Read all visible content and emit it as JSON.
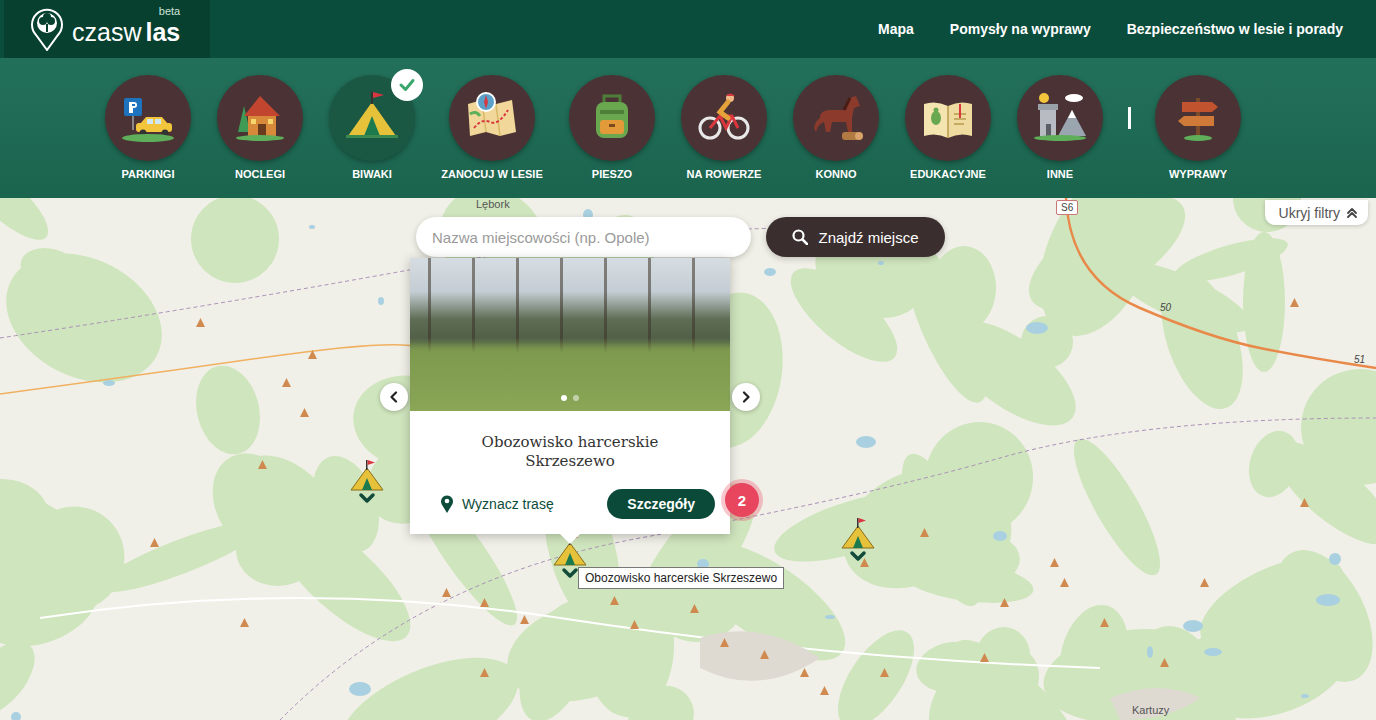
{
  "logo": {
    "parts": [
      {
        "text": "czas",
        "bold": false
      },
      {
        "text": "w",
        "bold": false
      },
      {
        "text": "las",
        "bold": true
      }
    ],
    "badge": "beta"
  },
  "nav": [
    {
      "label": "Mapa"
    },
    {
      "label": "Pomysły na wyprawy"
    },
    {
      "label": "Bezpieczeństwo w lesie i porady"
    }
  ],
  "categories": [
    {
      "label": "PARKINGI",
      "selected": false
    },
    {
      "label": "NOCLEGI",
      "selected": false
    },
    {
      "label": "BIWAKI",
      "selected": true
    },
    {
      "label": "ZANOCUJ W LESIE",
      "selected": false
    },
    {
      "label": "PIESZO",
      "selected": false
    },
    {
      "label": "NA ROWERZE",
      "selected": false
    },
    {
      "label": "KONNO",
      "selected": false
    },
    {
      "label": "EDUKACYJNE",
      "selected": false
    },
    {
      "label": "INNE",
      "selected": false
    }
  ],
  "trips": {
    "label": "WYPRAWY"
  },
  "filters_toggle": "Ukryj filtry",
  "search": {
    "placeholder": "Nazwa miejscowości (np. Opole)",
    "button": "Znajdź miejsce"
  },
  "popup": {
    "title": "Obozowisko harcerskie Skrzeszewo",
    "route": "Wyznacz trasę",
    "details": "Szczegóły",
    "photos": [
      {
        "selected": true
      },
      {
        "selected": false
      }
    ]
  },
  "cluster": {
    "count": "2"
  },
  "tooltip": "Obozowisko harcerskie Skrzeszewo",
  "map_labels": [
    {
      "text": "Lębork"
    },
    {
      "text": "Kartuzy"
    }
  ],
  "road_labels": [
    {
      "text": "S6"
    },
    {
      "text": "50"
    },
    {
      "text": "51"
    }
  ]
}
